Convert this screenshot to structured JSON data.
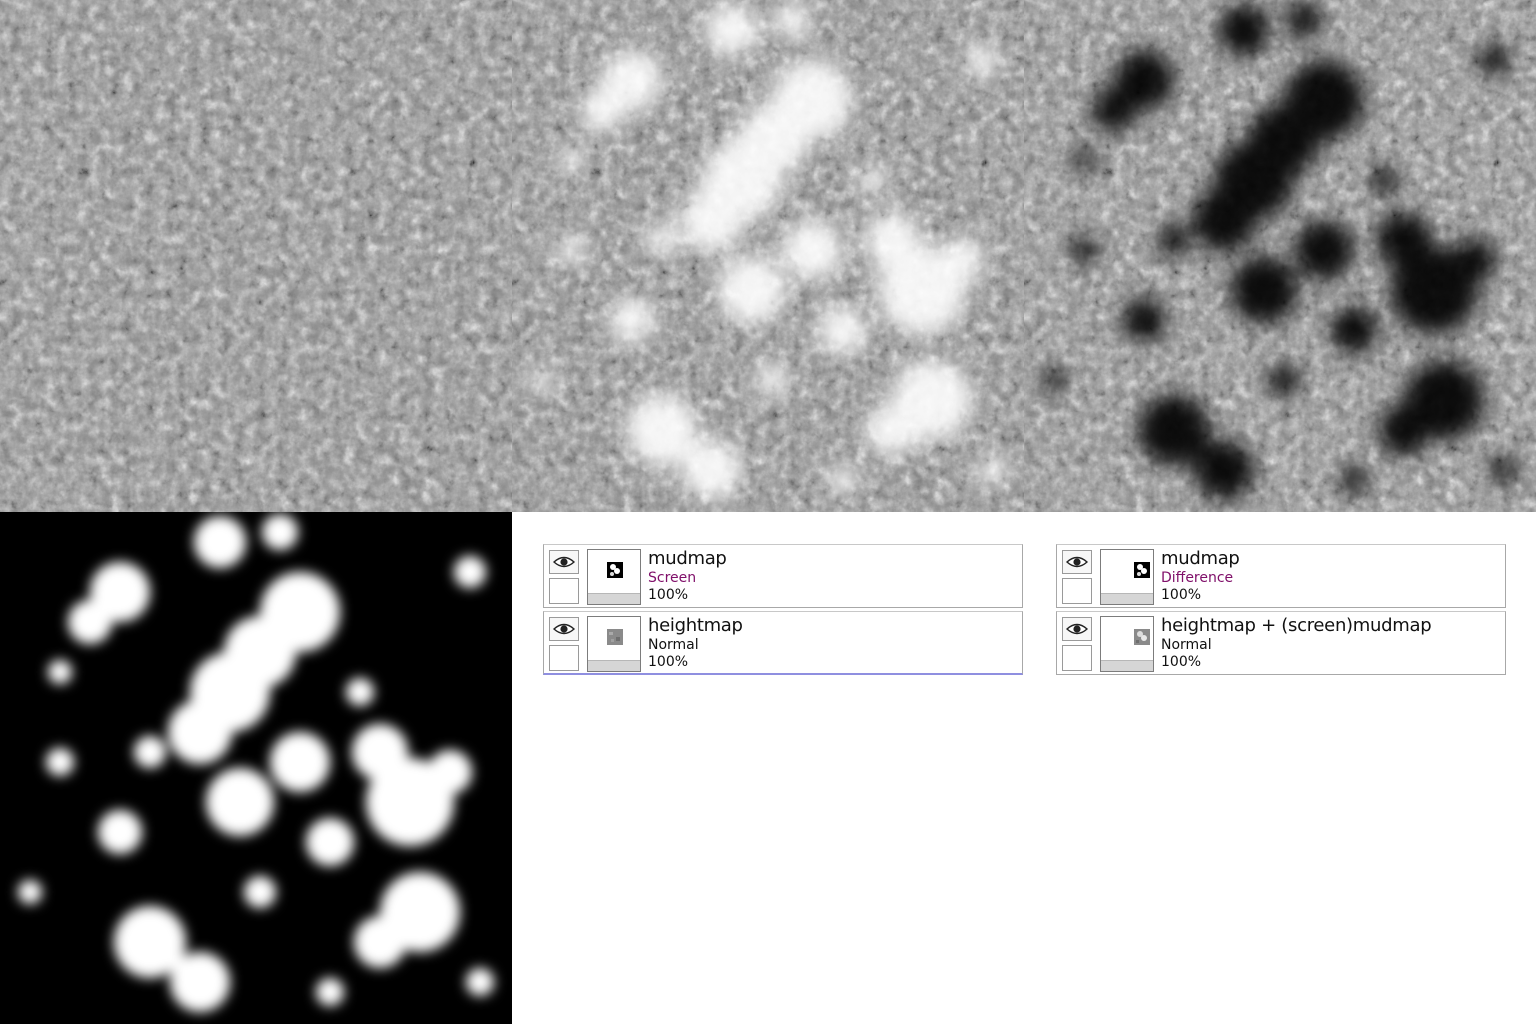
{
  "images": {
    "heightmap_tile": "heightmap texture",
    "heightmap_screen_tile": "heightmap with screen mudmap",
    "heightmap_difference_tile": "heightmap with difference mudmap",
    "mudmap_tile": "mudmap"
  },
  "panels": {
    "left": {
      "layers": [
        {
          "name": "mudmap",
          "mode": "Screen",
          "opacity": "100%",
          "mode_color": "#80106a",
          "visible_icon": "eye-icon"
        },
        {
          "name": "heightmap",
          "mode": "Normal",
          "opacity": "100%",
          "mode_color": "#111111",
          "visible_icon": "eye-icon"
        }
      ]
    },
    "right": {
      "layers": [
        {
          "name": "mudmap",
          "mode": "Difference",
          "opacity": "100%",
          "mode_color": "#80106a",
          "visible_icon": "eye-icon"
        },
        {
          "name": "heightmap + (screen)mudmap",
          "mode": "Normal",
          "opacity": "100%",
          "mode_color": "#111111",
          "visible_icon": "eye-icon"
        }
      ]
    }
  },
  "colors": {
    "selection_line": "#8f8fe0",
    "blend_mode_text": "#80106a"
  }
}
